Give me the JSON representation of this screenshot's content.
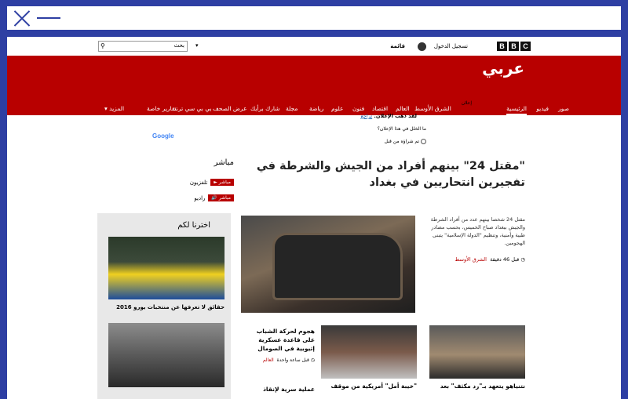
{
  "header": {
    "bbc_letters": [
      "B",
      "B",
      "C"
    ],
    "signin": "تسجيل الدخول",
    "menu": "قائمة",
    "search_placeholder": "بحث",
    "logo": "عربي"
  },
  "nav": {
    "items": [
      "الرئيسية",
      "فيديو",
      "صور",
      "الشرق الأوسط",
      "العالم",
      "اقتصاد",
      "فنون",
      "علوم",
      "رياضة",
      "مجلة",
      "شارك برأيك",
      "عرض الصحف",
      "بي بي سي ترند",
      "تقارير خاصة",
      "المزيد"
    ]
  },
  "ad": {
    "label": "إعلان",
    "gone": "لقد ذهب الإعلان.",
    "undo": "تراجع",
    "why": "ما الخلل في هذا الإعلان؟",
    "seen": "تم شراؤه من قبل",
    "google": "Google"
  },
  "live": {
    "title": "مباشر",
    "rows": [
      {
        "badge": "مباشر",
        "label": "تلفزيون"
      },
      {
        "badge": "مباشر",
        "label": "راديو"
      }
    ]
  },
  "lead": {
    "headline": "\"مقتل 24\" بينهم أفراد من الجيش والشرطة في تفجيرين انتحاريين في بغداد",
    "summary": "مقتل 24 شخصا بينهم عدد من أفراد الشرطة والجيش ببغداد صباح الخميس، بحسب مصادر طبية وأمنية، وتنظيم \"الدولة الإسلامية\" يتبنى الهجومين.",
    "time": "قبل 46 دقيقة",
    "tag": "الشرق الأوسط"
  },
  "sidebar": {
    "title": "اخترنا لكم",
    "caption1": "حقائق لا تعرفها عن منتخبات يورو 2016"
  },
  "cards": [
    {
      "caption": "نتنياهو يتعهد بـ\"رد مكثف\" بعد"
    },
    {
      "caption": "\"خيبة أمل\" أمريكية من موقف"
    }
  ],
  "story": {
    "title": "هجوم لحركة الشباب على قاعدة عسكرية إثيوبية في الصومال",
    "time": "قبل ساعة واحدة",
    "tag": "العالم",
    "next": "عملية سرية لإنقاذ"
  }
}
